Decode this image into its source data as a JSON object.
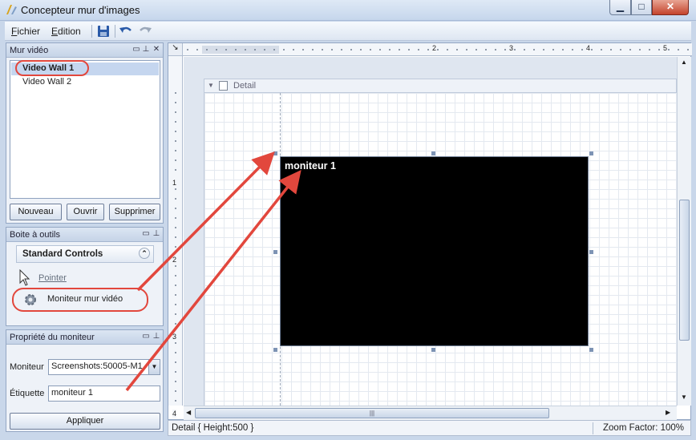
{
  "window": {
    "title": "Concepteur mur d'images"
  },
  "menu": {
    "fichier_first": "F",
    "fichier_rest": "ichier",
    "edition_first": "E",
    "edition_rest": "dition"
  },
  "wall_panel": {
    "title": "Mur vidéo",
    "items": [
      "Video Wall 1",
      "Video Wall 2"
    ],
    "buttons": {
      "nouveau": "Nouveau",
      "ouvrir": "Ouvrir",
      "supprimer": "Supprimer"
    }
  },
  "toolbox": {
    "title": "Boite à outils",
    "group": "Standard Controls",
    "items": [
      "Pointer",
      "Moniteur mur vidéo"
    ]
  },
  "props": {
    "title": "Propriété du moniteur",
    "moniteur_label": "Moniteur",
    "moniteur_value": "Screenshots:50005-M1",
    "etiquette_label": "Étiquette",
    "etiquette_value": "moniteur 1",
    "apply": "Appliquer"
  },
  "designer": {
    "band": "Detail",
    "monitor_label": "moniteur 1",
    "ruler_marks": [
      "1",
      "2",
      "3",
      "4",
      "5"
    ]
  },
  "status": {
    "left": "Detail { Height:500 }",
    "right": "Zoom Factor: 100%"
  },
  "colors": {
    "annotation": "#e2473d",
    "selection": "#c5d6ef"
  }
}
